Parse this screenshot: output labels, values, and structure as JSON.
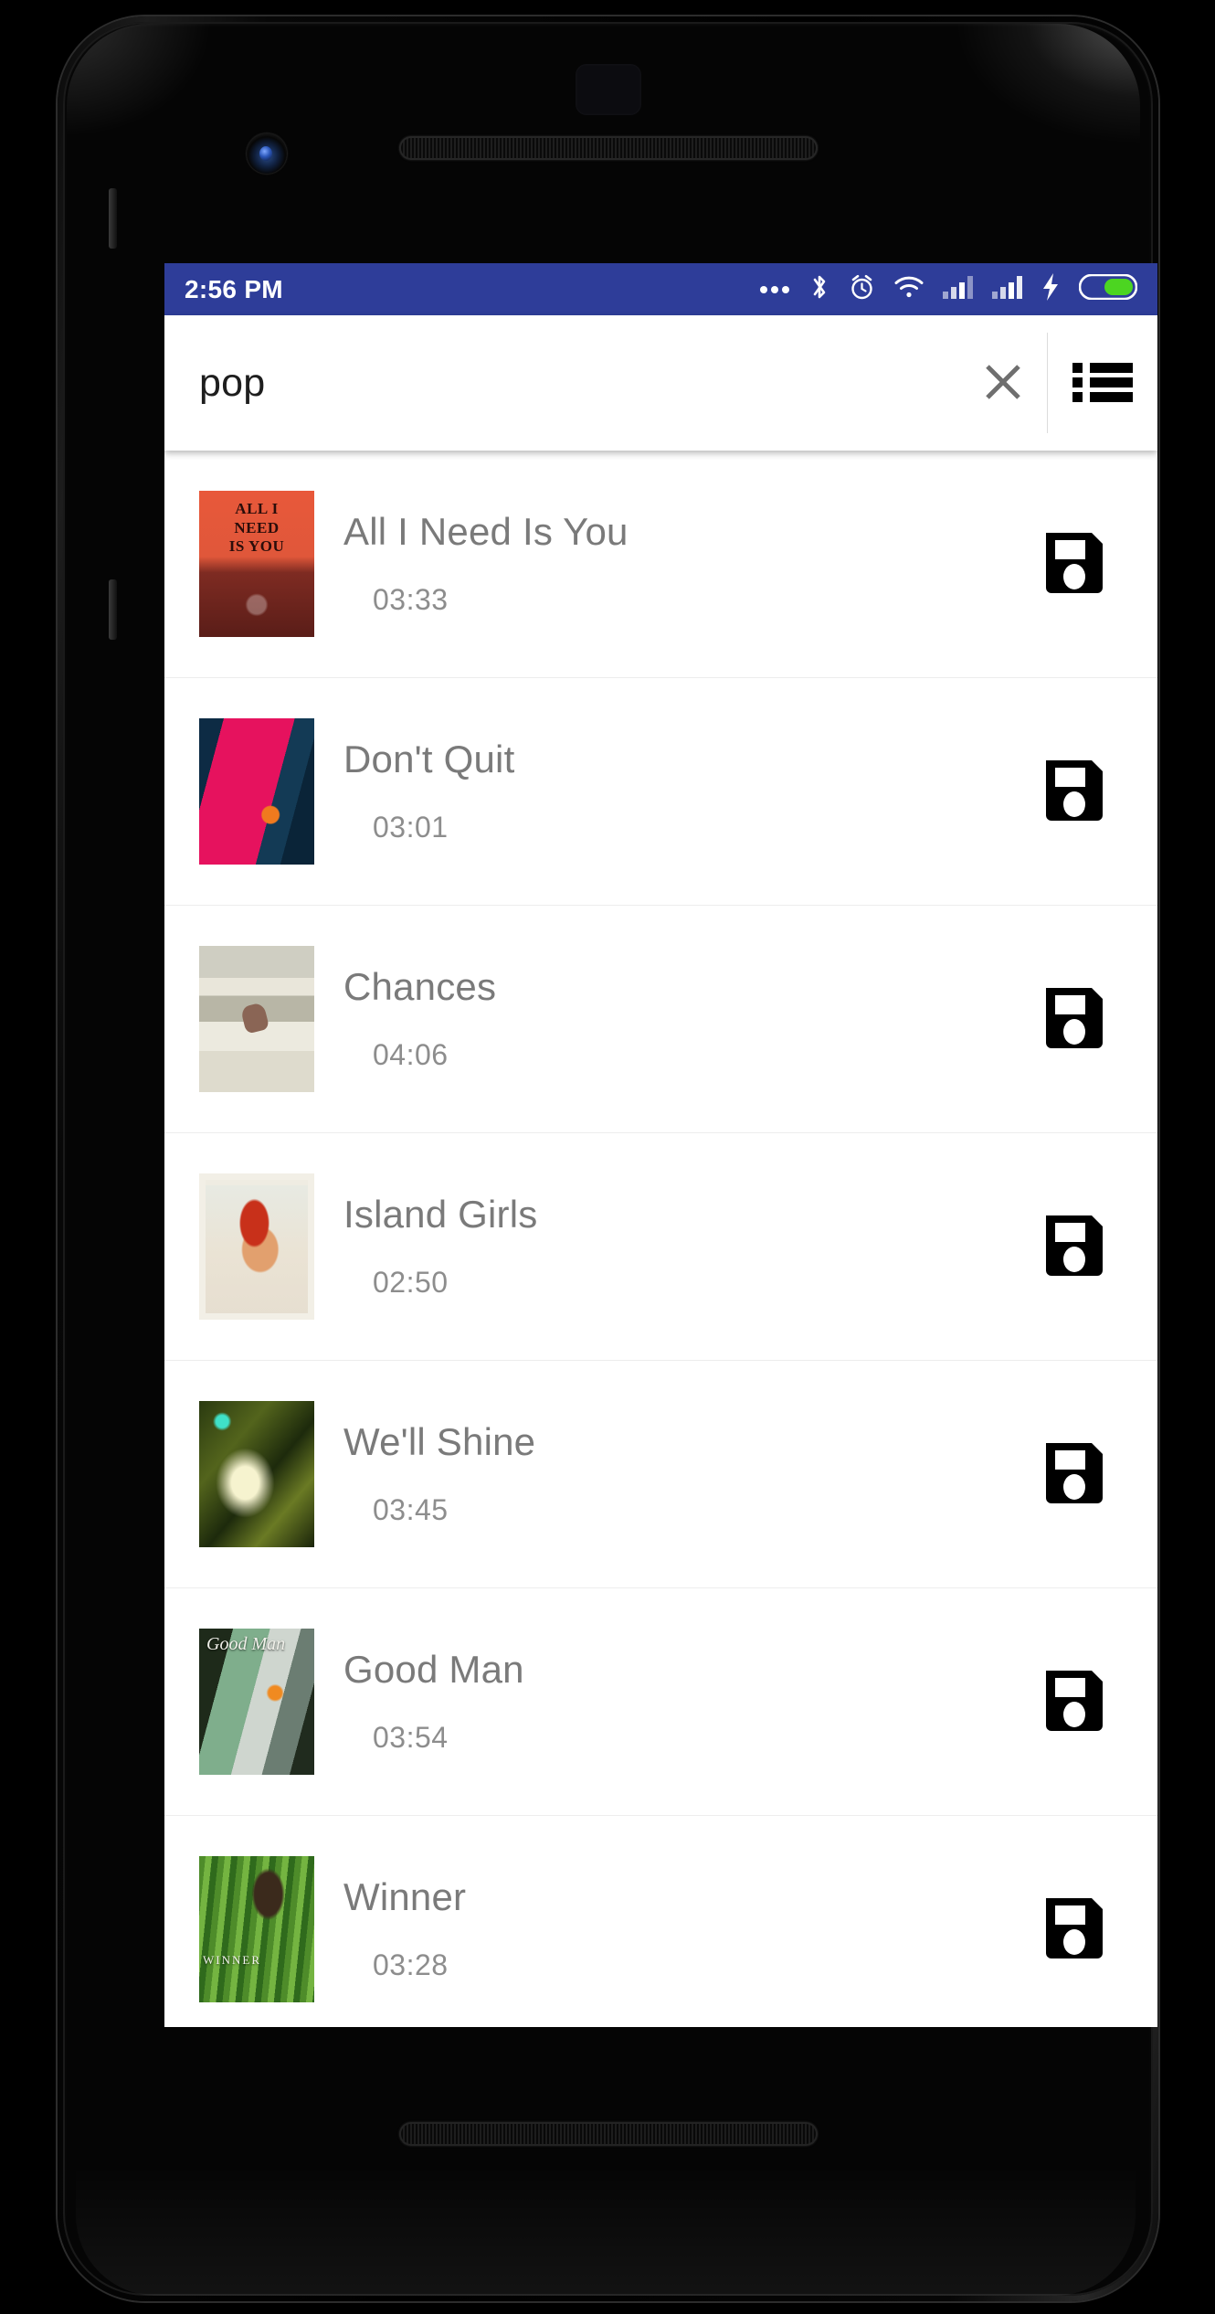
{
  "device": {
    "frame_name": "smartphone-mockup",
    "camera_icon": "front-camera-icon",
    "speaker_icon": "earpiece-speaker-icon",
    "bottom_speaker_icon": "bottom-speaker-icon"
  },
  "status_bar": {
    "time": "2:56 PM",
    "background_color": "#2e3d99",
    "text_color": "#ffffff",
    "icons": [
      {
        "name": "more-dots-icon",
        "label": "..."
      },
      {
        "name": "bluetooth-icon",
        "label": "Bluetooth"
      },
      {
        "name": "alarm-clock-icon",
        "label": "Alarm"
      },
      {
        "name": "wifi-icon",
        "label": "Wi-Fi"
      },
      {
        "name": "signal-sim1-icon",
        "label": "Signal 1"
      },
      {
        "name": "signal-sim2-icon",
        "label": "Signal 2"
      },
      {
        "name": "charging-bolt-icon",
        "label": "Charging"
      },
      {
        "name": "battery-icon",
        "label": "Battery",
        "color": "#4cd521"
      }
    ]
  },
  "search": {
    "value": "pop",
    "placeholder": "Search",
    "clear_icon": "close-x-icon",
    "menu_icon": "list-menu-icon"
  },
  "song_list": {
    "save_icon": "save-floppy-icon",
    "songs": [
      {
        "title": "All I Need Is You",
        "duration": "03:33",
        "art_class": "art-all-i-need",
        "art_name": "album-art-all-i-need-is-you"
      },
      {
        "title": "Don't Quit",
        "duration": "03:01",
        "art_class": "art-dont-quit",
        "art_name": "album-art-dont-quit"
      },
      {
        "title": "Chances",
        "duration": "04:06",
        "art_class": "art-chances",
        "art_name": "album-art-chances"
      },
      {
        "title": "Island Girls",
        "duration": "02:50",
        "art_class": "art-island-girls",
        "art_name": "album-art-island-girls"
      },
      {
        "title": "We'll Shine",
        "duration": "03:45",
        "art_class": "art-well-shine",
        "art_name": "album-art-well-shine"
      },
      {
        "title": "Good Man",
        "duration": "03:54",
        "art_class": "art-good-man",
        "art_name": "album-art-good-man"
      },
      {
        "title": "Winner",
        "duration": "03:28",
        "art_class": "art-winner",
        "art_name": "album-art-winner"
      }
    ]
  }
}
